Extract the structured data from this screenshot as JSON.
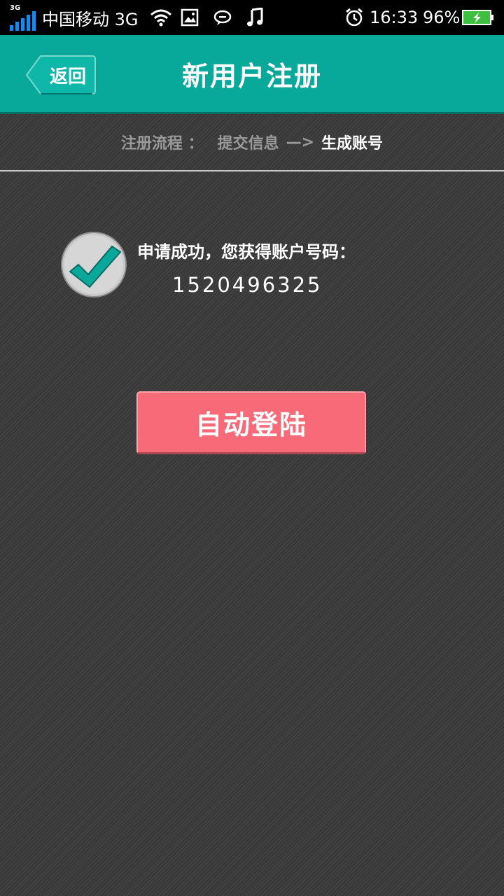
{
  "status_bar": {
    "network_gen": "3G",
    "carrier": "中国移动 3G",
    "time": "16:33",
    "battery_percent": "96%",
    "icons": [
      "signal-icon",
      "wifi-icon",
      "gallery-icon",
      "message-icon",
      "music-icon",
      "alarm-icon",
      "battery-icon"
    ]
  },
  "header": {
    "back_label": "返回",
    "title": "新用户注册"
  },
  "steps": {
    "prefix": "注册流程 ：",
    "step1": "提交信息",
    "arrow": "—>",
    "step2": "生成账号"
  },
  "result": {
    "message": "申请成功，您获得账户号码：",
    "account_number": "1520496325"
  },
  "actions": {
    "auto_login_label": "自动登陆"
  },
  "colors": {
    "header_bg": "#08a89a",
    "login_button": "#f86a78",
    "check_mark": "#0aa89a"
  }
}
